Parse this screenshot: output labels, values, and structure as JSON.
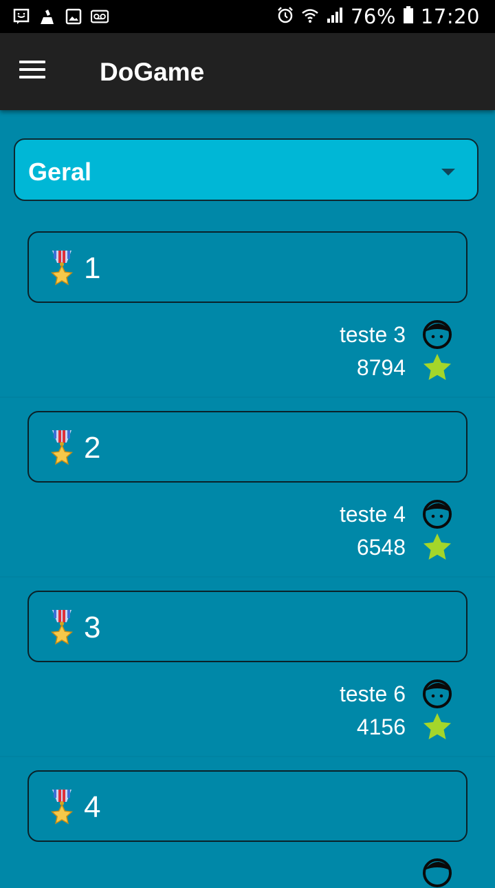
{
  "status_bar": {
    "icons": [
      "message-icon",
      "cleaner-icon",
      "gallery-icon",
      "voicemail-icon",
      "alarm-icon",
      "wifi-icon",
      "signal-icon",
      "battery-icon"
    ],
    "battery": "76%",
    "time": "17:20"
  },
  "app_bar": {
    "title": "DoGame",
    "menu_icon": "hamburger-icon"
  },
  "filter": {
    "selected": "Geral",
    "icon": "dropdown-arrow-icon"
  },
  "ranking": [
    {
      "position": "1",
      "player": "teste 3",
      "score": "8794"
    },
    {
      "position": "2",
      "player": "teste 4",
      "score": "6548"
    },
    {
      "position": "3",
      "player": "teste 6",
      "score": "4156"
    },
    {
      "position": "4",
      "player": "",
      "score": ""
    }
  ],
  "colors": {
    "background": "#0088a8",
    "app_bar": "#212121",
    "filter_bg": "#00b7d6",
    "star": "#a4d62a",
    "text": "#ffffff"
  }
}
